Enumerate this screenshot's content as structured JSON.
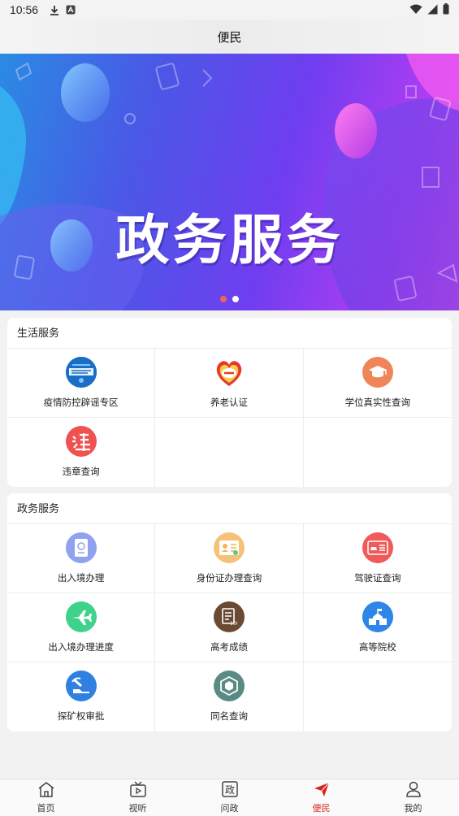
{
  "status_bar": {
    "time": "10:56"
  },
  "header": {
    "title": "便民"
  },
  "banner": {
    "text": "政务服务",
    "slides": 2,
    "active_slide": 0
  },
  "life_services": {
    "title": "生活服务",
    "items": [
      {
        "label": "疫情防控辟谣专区",
        "icon": "epidemic-rumor-icon",
        "color": "#1e73c8"
      },
      {
        "label": "养老认证",
        "icon": "elderly-care-icon",
        "color": "#e8453c"
      },
      {
        "label": "学位真实性查询",
        "icon": "graduation-cap-icon",
        "color": "#f0855a"
      },
      {
        "label": "违章查询",
        "icon": "traffic-violation-icon",
        "color": "#f05252"
      }
    ]
  },
  "gov_services": {
    "title": "政务服务",
    "items": [
      {
        "label": "出入境办理",
        "icon": "passport-icon",
        "color": "#8fa2f0"
      },
      {
        "label": "身份证办理查询",
        "icon": "id-card-icon",
        "color": "#f5c27a"
      },
      {
        "label": "驾驶证查询",
        "icon": "driver-license-icon",
        "color": "#f05a5a"
      },
      {
        "label": "出入境办理进度",
        "icon": "airplane-icon",
        "color": "#3fd28a"
      },
      {
        "label": "高考成绩",
        "icon": "exam-score-icon",
        "color": "#6b4a33"
      },
      {
        "label": "高等院校",
        "icon": "university-icon",
        "color": "#2e86e8"
      },
      {
        "label": "探矿权审批",
        "icon": "mining-icon",
        "color": "#2f80e0"
      },
      {
        "label": "同名查询",
        "icon": "name-search-icon",
        "color": "#5a8a84"
      }
    ]
  },
  "tabs": [
    {
      "label": "首页",
      "icon": "home-icon",
      "active": false
    },
    {
      "label": "视听",
      "icon": "tv-icon",
      "active": false
    },
    {
      "label": "问政",
      "icon": "politics-icon",
      "glyph": "政",
      "active": false
    },
    {
      "label": "便民",
      "icon": "paper-plane-icon",
      "active": true
    },
    {
      "label": "我的",
      "icon": "user-icon",
      "active": false
    }
  ],
  "colors": {
    "accent": "#d9241c",
    "banner_start": "#2a8be3",
    "banner_end": "#e04cf0"
  }
}
